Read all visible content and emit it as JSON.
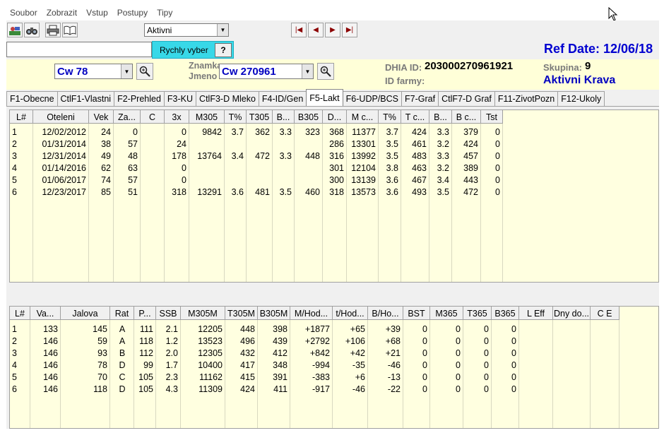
{
  "menu": [
    "Soubor",
    "Zobrazit",
    "Vstup",
    "Postupy",
    "Tipy"
  ],
  "toolbar": {
    "status_combo": "Aktivni",
    "icons": [
      "cow-import-icon",
      "binoculars-icon",
      "printer-icon",
      "book-icon"
    ],
    "nav": [
      "first-record-icon",
      "previous-record-icon",
      "next-record-icon",
      "last-record-icon"
    ]
  },
  "quick": {
    "label": "Rychly vyber",
    "button": "?"
  },
  "ref_date": "Ref Date: 12/06/18",
  "animal": {
    "group_combo": "Cw 78",
    "label_znamka": "Znamka",
    "label_jmeno": "Jmeno",
    "name_combo": "Cw  270961",
    "dhia_label": "DHIA ID:",
    "dhia_value": "203000270961921",
    "farm_label": "ID farmy:",
    "skupina_label": "Skupina:",
    "skupina_value": "9",
    "status": "Aktivni Krava"
  },
  "tabs": [
    "F1-Obecne",
    "CtlF1-Vlastni",
    "F2-Prehled",
    "F3-KU",
    "CtlF3-D Mleko",
    "F4-ID/Gen",
    "F5-Lakt",
    "F6-UDP/BCS",
    "F7-Graf",
    "CtlF7-D Graf",
    "F11-ZivotPozn",
    "F12-Ukoly"
  ],
  "active_tab": "F5-Lakt",
  "table1": {
    "headers": [
      "L#",
      "Oteleni",
      "Vek",
      "Za...",
      "C",
      "3x",
      "M305",
      "T%",
      "T305",
      "B...",
      "B305",
      "D...",
      "M c...",
      "T%",
      "T c...",
      "B...",
      "B c...",
      "Tst"
    ],
    "rows": [
      [
        "1",
        "12/02/2012",
        "24",
        "0",
        "",
        "0",
        "9842",
        "3.7",
        "362",
        "3.3",
        "323",
        "368",
        "11377",
        "3.7",
        "424",
        "3.3",
        "379",
        "0"
      ],
      [
        "2",
        "01/31/2014",
        "38",
        "57",
        "",
        "24",
        "",
        "",
        "",
        "",
        "",
        "286",
        "13301",
        "3.5",
        "461",
        "3.2",
        "424",
        "0"
      ],
      [
        "3",
        "12/31/2014",
        "49",
        "48",
        "",
        "178",
        "13764",
        "3.4",
        "472",
        "3.3",
        "448",
        "316",
        "13992",
        "3.5",
        "483",
        "3.3",
        "457",
        "0"
      ],
      [
        "4",
        "01/14/2016",
        "62",
        "63",
        "",
        "0",
        "",
        "",
        "",
        "",
        "",
        "301",
        "12104",
        "3.8",
        "463",
        "3.2",
        "389",
        "0"
      ],
      [
        "5",
        "01/06/2017",
        "74",
        "57",
        "",
        "0",
        "",
        "",
        "",
        "",
        "",
        "300",
        "13139",
        "3.6",
        "467",
        "3.4",
        "443",
        "0"
      ],
      [
        "6",
        "12/23/2017",
        "85",
        "51",
        "",
        "318",
        "13291",
        "3.6",
        "481",
        "3.5",
        "460",
        "318",
        "13573",
        "3.6",
        "493",
        "3.5",
        "472",
        "0"
      ]
    ]
  },
  "table2": {
    "headers": [
      "L#",
      "Va...",
      "Jalova",
      "Rat",
      "P...",
      "SSB",
      "M305M",
      "T305M",
      "B305M",
      "M/Hod...",
      "t/Hod...",
      "B/Ho...",
      "BST",
      "M365",
      "T365",
      "B365",
      "L Eff",
      "Dny do...",
      "C E"
    ],
    "rows": [
      [
        "1",
        "133",
        "145",
        "A",
        "111",
        "2.1",
        "12205",
        "448",
        "398",
        "+1877",
        "+65",
        "+39",
        "0",
        "0",
        "0",
        "0",
        "",
        "",
        ""
      ],
      [
        "2",
        "146",
        "59",
        "A",
        "118",
        "1.2",
        "13523",
        "496",
        "439",
        "+2792",
        "+106",
        "+68",
        "0",
        "0",
        "0",
        "0",
        "",
        "",
        ""
      ],
      [
        "3",
        "146",
        "93",
        "B",
        "112",
        "2.0",
        "12305",
        "432",
        "412",
        "+842",
        "+42",
        "+21",
        "0",
        "0",
        "0",
        "0",
        "",
        "",
        ""
      ],
      [
        "4",
        "146",
        "78",
        "D",
        "99",
        "1.7",
        "10400",
        "417",
        "348",
        "-994",
        "-35",
        "-46",
        "0",
        "0",
        "0",
        "0",
        "",
        "",
        ""
      ],
      [
        "5",
        "146",
        "70",
        "C",
        "105",
        "2.3",
        "11162",
        "415",
        "391",
        "-383",
        "+6",
        "-13",
        "0",
        "0",
        "0",
        "0",
        "",
        "",
        ""
      ],
      [
        "6",
        "146",
        "118",
        "D",
        "105",
        "4.3",
        "11309",
        "424",
        "411",
        "-917",
        "-46",
        "-22",
        "0",
        "0",
        "0",
        "0",
        "",
        "",
        ""
      ]
    ]
  }
}
